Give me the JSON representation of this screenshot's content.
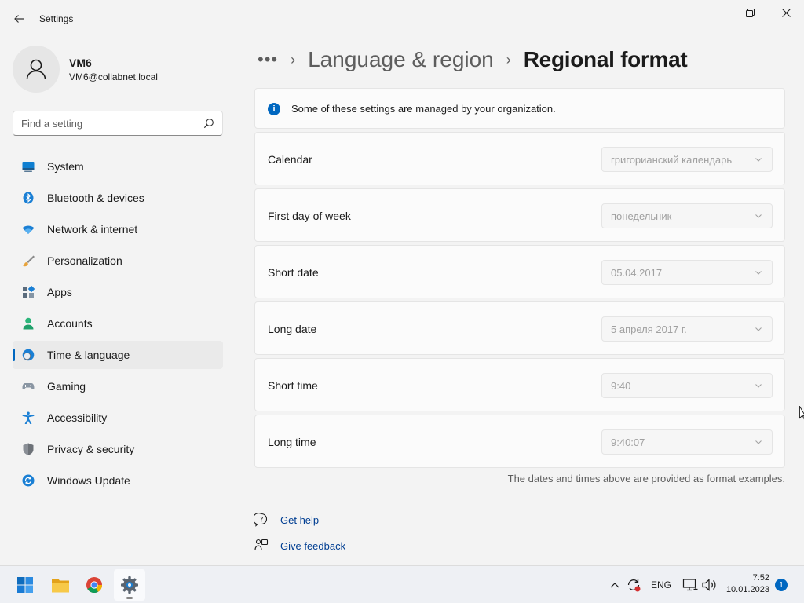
{
  "window": {
    "title": "Settings",
    "back_icon": "back-arrow-icon",
    "controls": [
      "minimize-icon",
      "maximize-icon",
      "close-icon"
    ]
  },
  "profile": {
    "name": "VM6",
    "email": "VM6@collabnet.local"
  },
  "search": {
    "placeholder": "Find a setting"
  },
  "sidebar": {
    "items": [
      {
        "label": "System",
        "icon": "system-icon",
        "active": false
      },
      {
        "label": "Bluetooth & devices",
        "icon": "bluetooth-icon",
        "active": false
      },
      {
        "label": "Network & internet",
        "icon": "wifi-icon",
        "active": false
      },
      {
        "label": "Personalization",
        "icon": "brush-icon",
        "active": false
      },
      {
        "label": "Apps",
        "icon": "apps-icon",
        "active": false
      },
      {
        "label": "Accounts",
        "icon": "accounts-icon",
        "active": false
      },
      {
        "label": "Time & language",
        "icon": "globe-clock-icon",
        "active": true
      },
      {
        "label": "Gaming",
        "icon": "gamepad-icon",
        "active": false
      },
      {
        "label": "Accessibility",
        "icon": "accessibility-icon",
        "active": false
      },
      {
        "label": "Privacy & security",
        "icon": "shield-icon",
        "active": false
      },
      {
        "label": "Windows Update",
        "icon": "update-icon",
        "active": false
      }
    ]
  },
  "breadcrumb": {
    "more": "•••",
    "sep": "›",
    "parent": "Language & region",
    "current": "Regional format"
  },
  "info_banner": {
    "text": "Some of these settings are managed by your organization."
  },
  "settings": [
    {
      "label": "Calendar",
      "value": "григорианский календарь"
    },
    {
      "label": "First day of week",
      "value": "понедельник"
    },
    {
      "label": "Short date",
      "value": "05.04.2017"
    },
    {
      "label": "Long date",
      "value": "5 апреля 2017 г."
    },
    {
      "label": "Short time",
      "value": "9:40"
    },
    {
      "label": "Long time",
      "value": "9:40:07"
    }
  ],
  "footnote": "The dates and times above are provided as format examples.",
  "help_links": {
    "get_help": "Get help",
    "give_feedback": "Give feedback"
  },
  "taskbar": {
    "apps": [
      "windows-start-icon",
      "file-explorer-icon",
      "chrome-icon",
      "settings-gear-icon"
    ],
    "language": "ENG",
    "time": "7:52",
    "date": "10.01.2023",
    "notifications": "1"
  },
  "colors": {
    "accent": "#0067c0",
    "background": "#f3f3f3",
    "card": "#fbfbfb",
    "link": "#003e92"
  }
}
